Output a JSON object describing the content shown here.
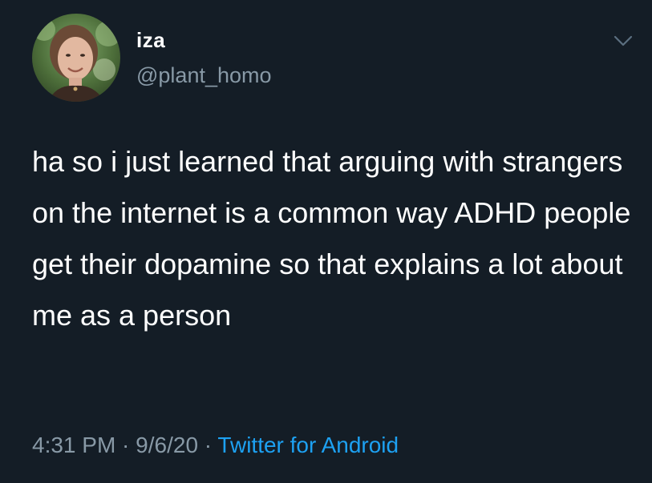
{
  "tweet": {
    "display_name": "iza",
    "handle": "@plant_homo",
    "text": "ha so i just learned that arguing with strangers on the internet is a common way ADHD people get their dopamine so that explains a lot about me as a person",
    "time": "4:31 PM",
    "separator": " · ",
    "date": "9/6/20",
    "source": "Twitter for Android"
  },
  "icons": {
    "caret": "chevron-down-icon"
  },
  "colors": {
    "background": "#141d26",
    "text": "#ffffff",
    "muted": "#8899a6",
    "link": "#1da1f2"
  }
}
